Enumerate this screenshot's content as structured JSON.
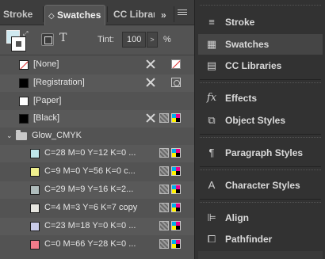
{
  "tabs": [
    {
      "label": "Stroke",
      "active": false
    },
    {
      "label": "Swatches",
      "active": true,
      "glyph": "◇"
    },
    {
      "label": "CC Libraries",
      "active": false
    }
  ],
  "tab_overflow": "»",
  "controls": {
    "fill_color": "#cfe9f0",
    "text_format_glyph": "T",
    "tint_label": "Tint:",
    "tint_value": "100",
    "tint_arrow": ">",
    "tint_unit": "%"
  },
  "swatches": [
    {
      "name": "[None]",
      "color": "none",
      "icons": [
        "no-edit",
        "none"
      ]
    },
    {
      "name": "[Registration]",
      "color": "#000000",
      "icons": [
        "no-edit",
        "registration"
      ]
    },
    {
      "name": "[Paper]",
      "color": "#ffffff",
      "icons": []
    },
    {
      "name": "[Black]",
      "color": "#000000",
      "icons": [
        "no-edit",
        "process",
        "cmyk"
      ]
    }
  ],
  "group": {
    "name": "Glow_CMYK",
    "chevron": "⌄",
    "items": [
      {
        "name": "C=28 M=0 Y=12 K=0 ...",
        "color": "#bfe6ea"
      },
      {
        "name": "C=9 M=0 Y=56 K=0 c...",
        "color": "#f0f08e"
      },
      {
        "name": "C=29 M=9 Y=16 K=2...",
        "color": "#afbcbc"
      },
      {
        "name": "C=4 M=3 Y=6 K=7 copy",
        "color": "#e7e6e0"
      },
      {
        "name": "C=23 M=18 Y=0 K=0 ...",
        "color": "#c8cbe8"
      },
      {
        "name": "C=0 M=66 Y=28 K=0 ...",
        "color": "#f07b8a"
      }
    ]
  },
  "dock": [
    {
      "label": "Stroke",
      "icon": "stroke-icon",
      "glyph": "≡",
      "active": false
    },
    {
      "label": "Swatches",
      "icon": "swatches-icon",
      "glyph": "▦",
      "active": true
    },
    {
      "label": "CC Libraries",
      "icon": "cc-libraries-icon",
      "glyph": "▤",
      "active": false
    },
    {
      "label": "Effects",
      "icon": "effects-icon",
      "glyph": "fx",
      "active": false
    },
    {
      "label": "Object Styles",
      "icon": "object-styles-icon",
      "glyph": "⧉",
      "active": false
    },
    {
      "label": "Paragraph Styles",
      "icon": "paragraph-styles-icon",
      "glyph": "¶",
      "active": false
    },
    {
      "label": "Character Styles",
      "icon": "character-styles-icon",
      "glyph": "A",
      "active": false
    },
    {
      "label": "Align",
      "icon": "align-icon",
      "glyph": "⊫",
      "active": false
    },
    {
      "label": "Pathfinder",
      "icon": "pathfinder-icon",
      "glyph": "⧠",
      "active": false
    }
  ]
}
